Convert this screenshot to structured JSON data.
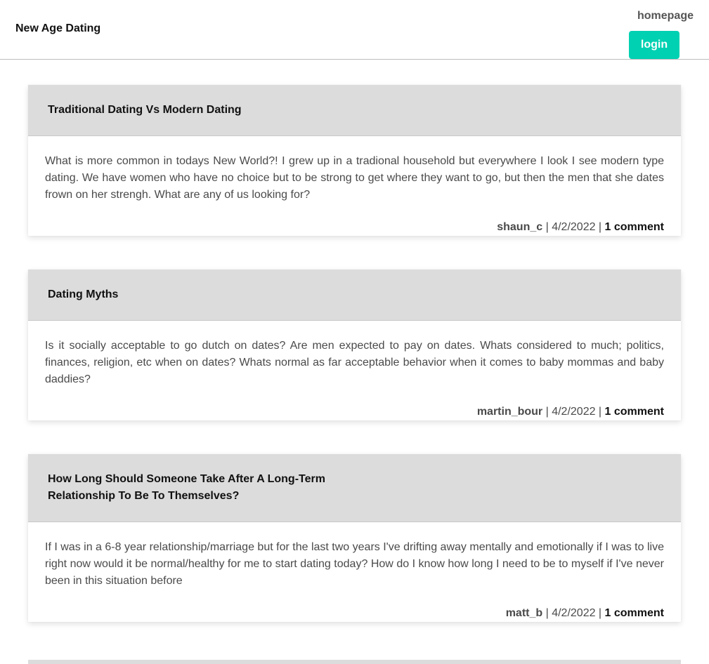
{
  "header": {
    "site_title": "New Age Dating",
    "nav_home": "homepage",
    "login_label": "login"
  },
  "colors": {
    "accent": "#00d1b2",
    "card_header": "#dcdcdc"
  },
  "posts": [
    {
      "title": "Traditional Dating Vs Modern Dating",
      "body": "What is more common in todays New World?! I grew up in a tradional household but everywhere I look I see modern type dating. We have women who have no choice but to be strong to get where they want to go, but then the men that she dates frown on her strengh. What are any of us looking for?",
      "user": "shaun_c",
      "sep1": " | ",
      "date": "4/2/2022",
      "sep2": " | ",
      "comments": "1 comment"
    },
    {
      "title": "Dating Myths",
      "body": "Is it socially acceptable to go dutch on dates? Are men expected to pay on dates. Whats considered to much; politics, finances, religion, etc when on dates? Whats normal as far acceptable behavior when it comes to baby mommas and baby daddies?",
      "user": "martin_bour",
      "sep1": " | ",
      "date": "4/2/2022",
      "sep2": " | ",
      "comments": "1 comment"
    },
    {
      "title": "How Long Should Someone Take After A Long-Term Relationship To Be To Themselves?",
      "body": "If I was in a 6-8 year relationship/marriage but for the last two years I've drifting away mentally and emotionally if I was to live right now would it be normal/healthy for me to start dating today? How do I know how long I need to be to myself if I've never been in this situation before",
      "user": "matt_b",
      "sep1": " | ",
      "date": "4/2/2022",
      "sep2": " | ",
      "comments": "1 comment"
    }
  ]
}
